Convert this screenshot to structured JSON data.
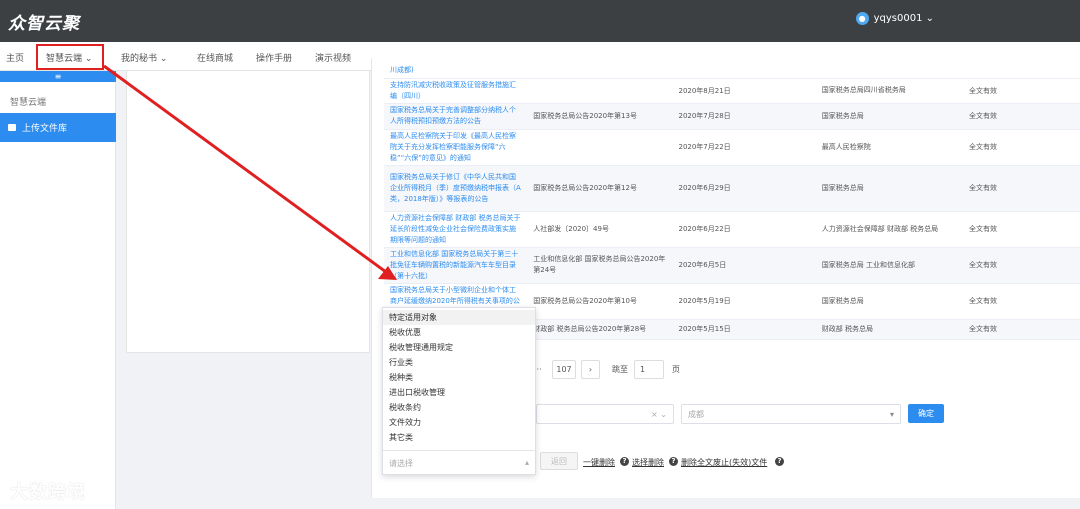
{
  "header": {
    "logo": "众智云聚",
    "user": "yqys0001 ⌄"
  },
  "nav": {
    "home": "主页",
    "cloud": "智慧云端 ⌄",
    "secretary": "我的秘书 ⌄",
    "store": "在线商城",
    "manual": "操作手册",
    "video": "演示视频"
  },
  "sidebar": {
    "collapse": "≡",
    "section": "智慧云端",
    "upload": "上传文件库"
  },
  "table": {
    "partial_heading": "川成都)",
    "rows": [
      {
        "title": "支持防汛减灾税收政策及征管服务措施汇编（四川）",
        "doc": "",
        "date": "2020年8月21日",
        "org": "国家税务总局四川省税务局",
        "status": "全文有效"
      },
      {
        "title": "国家税务总局关于完善调整部分纳税人个人所得税预扣预缴方法的公告",
        "doc": "国家税务总局公告2020年第13号",
        "date": "2020年7月28日",
        "org": "国家税务总局",
        "status": "全文有效"
      },
      {
        "title": "最高人民检察院关于印发《最高人民检察院关于充分发挥检察职能服务保障“六稳”“六保”的意见》的通知",
        "doc": "",
        "date": "2020年7月22日",
        "org": "最高人民检察院",
        "status": "全文有效"
      },
      {
        "title": "国家税务总局关于修订《中华人民共和国企业所得税月（季）度预缴纳税申报表（A类，2018年版）》等报表的公告",
        "doc": "国家税务总局公告2020年第12号",
        "date": "2020年6月29日",
        "org": "国家税务总局",
        "status": "全文有效"
      },
      {
        "title": "人力资源社会保障部 财政部 税务总局关于延长阶段性减免企业社会保险费政策实施期限等问题的通知",
        "doc": "人社部发〔2020〕49号",
        "date": "2020年6月22日",
        "org": "人力资源社会保障部 财政部 税务总局",
        "status": "全文有效"
      },
      {
        "title": "工业和信息化部 国家税务总局关于第三十批免征车辆购置税的新能源汽车车型目录（第十六批）",
        "doc": "工业和信息化部 国家税务总局公告2020年第24号",
        "date": "2020年6月5日",
        "org": "国家税务总局 工业和信息化部",
        "status": "全文有效"
      },
      {
        "title": "国家税务总局关于小型微利企业和个体工商户延缓缴纳2020年所得税有关事项的公告",
        "doc": "国家税务总局公告2020年第10号",
        "date": "2020年5月19日",
        "org": "国家税务总局",
        "status": "全文有效"
      },
      {
        "title": "",
        "doc": "财政部 税务总局公告2020年第28号",
        "date": "2020年5月15日",
        "org": "财政部 税务总局",
        "status": "全文有效"
      }
    ]
  },
  "pager": {
    "ellipsis": "···",
    "last_page": "107",
    "next": "›",
    "goto": "跳至",
    "page_value": "1",
    "page_unit": "页"
  },
  "filters": {
    "clear": "× ⌄",
    "region_placeholder": "成都",
    "region_arrow": "▾",
    "confirm": "确定"
  },
  "dropdown": {
    "items": [
      "特定适用对象",
      "税收优惠",
      "税收管理通用规定",
      "行业类",
      "税种类",
      "进出口税收管理",
      "税收条约",
      "文件效力",
      "其它类"
    ],
    "placeholder": "请选择",
    "arrow": "▴"
  },
  "actions": {
    "back": "返回",
    "delete_one": "一键删除",
    "select_delete": "选择删除",
    "delete_invalid": "删除全文废止(失效)文件",
    "help": "?"
  },
  "watermark": "大数跨境",
  "colors": {
    "primary": "#2d8cf0",
    "highlight": "#e02020",
    "topbar": "#3c4043"
  }
}
